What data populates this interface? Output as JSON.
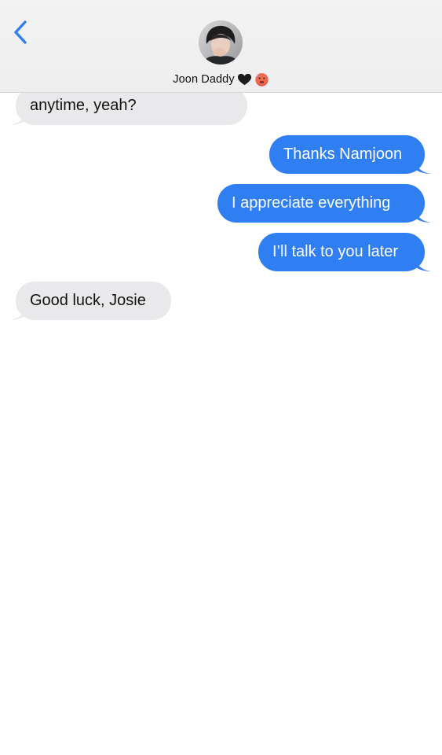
{
  "header": {
    "back_icon": "chevron-left-icon",
    "contact_name": "Joon Daddy",
    "name_emojis": [
      "black-heart-icon",
      "hot-face-icon"
    ],
    "avatar_icon": "contact-avatar"
  },
  "messages": [
    {
      "direction": "incoming",
      "text": "anytime, yeah?"
    },
    {
      "direction": "outgoing",
      "text": "Thanks Namjoon"
    },
    {
      "direction": "outgoing",
      "text": "I appreciate everything"
    },
    {
      "direction": "outgoing",
      "text": "I’ll talk to you later"
    },
    {
      "direction": "incoming",
      "text": "Good luck, Josie"
    }
  ],
  "colors": {
    "accent": "#2f7ff3",
    "incoming_bubble": "#e9e9eb",
    "header_bg": "#f2f2f3"
  }
}
